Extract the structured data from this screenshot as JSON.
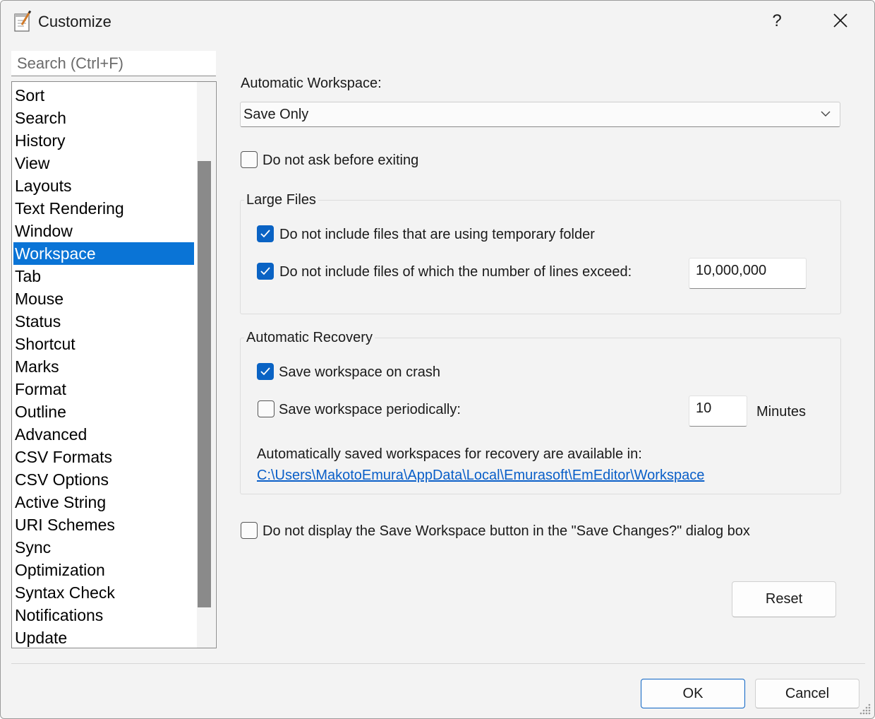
{
  "window": {
    "title": "Customize",
    "help_glyph": "?",
    "icons": [
      "notepad-app-icon",
      "close-icon"
    ]
  },
  "sidebar": {
    "search_placeholder": "Search (Ctrl+F)",
    "items": [
      {
        "label": "Sort"
      },
      {
        "label": "Search"
      },
      {
        "label": "History"
      },
      {
        "label": "View"
      },
      {
        "label": "Layouts"
      },
      {
        "label": "Text Rendering"
      },
      {
        "label": "Window"
      },
      {
        "label": "Workspace"
      },
      {
        "label": "Tab"
      },
      {
        "label": "Mouse"
      },
      {
        "label": "Status"
      },
      {
        "label": "Shortcut"
      },
      {
        "label": "Marks"
      },
      {
        "label": "Format"
      },
      {
        "label": "Outline"
      },
      {
        "label": "Advanced"
      },
      {
        "label": "CSV Formats"
      },
      {
        "label": "CSV Options"
      },
      {
        "label": "Active String"
      },
      {
        "label": "URI Schemes"
      },
      {
        "label": "Sync"
      },
      {
        "label": "Optimization"
      },
      {
        "label": "Syntax Check"
      },
      {
        "label": "Notifications"
      },
      {
        "label": "Update"
      }
    ],
    "selected_index": 7
  },
  "workspace": {
    "auto_workspace_label": "Automatic Workspace:",
    "auto_workspace_value": "Save Only",
    "do_not_ask_label": "Do not ask before exiting",
    "do_not_ask_checked": false,
    "large_files": {
      "title": "Large Files",
      "temp_folder_label": "Do not include files that are using temporary folder",
      "temp_folder_checked": true,
      "lines_exceed_label": "Do not include files of which the number of lines exceed:",
      "lines_exceed_checked": true,
      "lines_value": "10,000,000"
    },
    "recovery": {
      "title": "Automatic Recovery",
      "on_crash_label": "Save workspace on crash",
      "on_crash_checked": true,
      "periodic_label": "Save workspace periodically:",
      "periodic_checked": false,
      "periodic_value": "10",
      "minutes_label": "Minutes",
      "info_text": "Automatically saved workspaces for recovery are available in:",
      "path_link": "C:\\Users\\MakotoEmura\\AppData\\Local\\Emurasoft\\EmEditor\\Workspace"
    },
    "hide_save_button_label": "Do not display the Save Workspace button in the \"Save Changes?\" dialog box",
    "hide_save_button_checked": false,
    "reset_label": "Reset"
  },
  "footer": {
    "ok_label": "OK",
    "cancel_label": "Cancel"
  },
  "colors": {
    "accent": "#0a63c4",
    "selection": "#0a74d6",
    "link": "#0a5fc8"
  }
}
